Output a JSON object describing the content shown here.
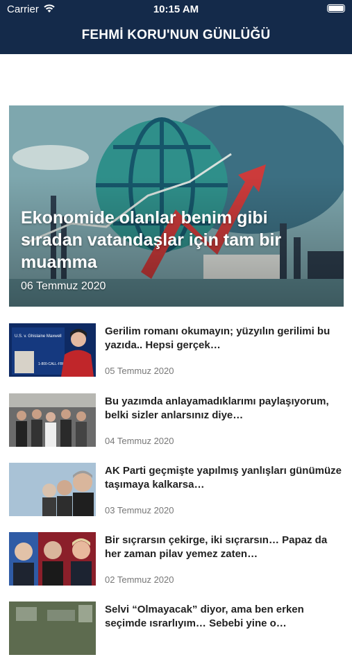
{
  "status_bar": {
    "carrier": "Carrier",
    "time": "10:15 AM"
  },
  "header": {
    "title": "FEHMİ KORU'NUN GÜNLÜĞÜ"
  },
  "featured": {
    "title": "Ekonomide olanlar benim gibi sıradan vatandaşlar için tam bir muamma",
    "date": "06 Temmuz 2020"
  },
  "articles": [
    {
      "title": "Gerilim romanı okumayın; yüzyılın gerilimi bu yazıda.. Hepsi gerçek…",
      "date": "05 Temmuz 2020"
    },
    {
      "title": "Bu yazımda anlayamadıklarımı paylaşıyorum, belki sizler anlarsınız diye…",
      "date": "04 Temmuz 2020"
    },
    {
      "title": "AK Parti geçmişte yapılmış yanlışları günümüze taşımaya kalkarsa…",
      "date": "03 Temmuz 2020"
    },
    {
      "title": "Bir sıçrarsın çekirge, iki sıçrarsın… Papaz da her zaman pilav yemez zaten…",
      "date": "02 Temmuz 2020"
    },
    {
      "title": "Selvi “Olmayacak” diyor, ama ben erken seçimde ısrarlıyım… Sebebi yine o…",
      "date": ""
    }
  ],
  "thumb_text": {
    "first": "U.S. v. Ghislaine Maxwell",
    "first_sub": "1-800-CALL-FBI"
  },
  "colors": {
    "header_bg": "#142a4a",
    "text": "#222222",
    "date": "#777777"
  }
}
